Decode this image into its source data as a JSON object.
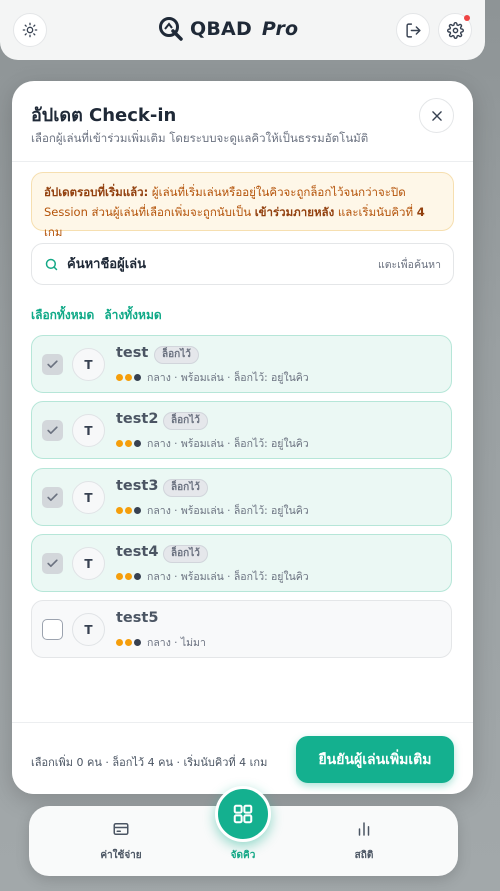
{
  "app": {
    "name": "QBAD",
    "edition": "Pro"
  },
  "modal": {
    "title": "อัปเดต Check-in",
    "subtitle": "เลือกผู้เล่นที่เข้าร่วมเพิ่มเติม โดยระบบจะดูแลคิวให้เป็นธรรมอัตโนมัติ",
    "alert": {
      "lead": "อัปเดตรอบที่เริ่มแล้ว:",
      "text1": " ผู้เล่นที่เริ่มเล่นหรืออยู่ในคิวจะถูกล็อกไว้จนกว่าจะปิด Session ส่วนผู้เล่นที่เลือกเพิ่มจะถูกนับเป็น ",
      "emph": "เข้าร่วมภายหลัง",
      "text2": " และเริ่มนับคิวที่ ",
      "num": "4",
      "text3": " เกม"
    },
    "search": {
      "placeholder": "ค้นหาชื่อผู้เล่น",
      "hint": "แตะเพื่อค้นหา"
    },
    "select_all": "เลือกทั้งหมด",
    "clear_all": "ล้างทั้งหมด",
    "players": [
      {
        "initial": "T",
        "name": "test",
        "badge": "ล็อกไว้",
        "meta": "กลาง · พร้อมเล่น · ล็อกไว้: อยู่ในคิว",
        "checked": true
      },
      {
        "initial": "T",
        "name": "test2",
        "badge": "ล็อกไว้",
        "meta": "กลาง · พร้อมเล่น · ล็อกไว้: อยู่ในคิว",
        "checked": true
      },
      {
        "initial": "T",
        "name": "test3",
        "badge": "ล็อกไว้",
        "meta": "กลาง · พร้อมเล่น · ล็อกไว้: อยู่ในคิว",
        "checked": true
      },
      {
        "initial": "T",
        "name": "test4",
        "badge": "ล็อกไว้",
        "meta": "กลาง · พร้อมเล่น · ล็อกไว้: อยู่ในคิว",
        "checked": true
      },
      {
        "initial": "T",
        "name": "test5",
        "badge": "",
        "meta": "กลาง · ไม่มา",
        "checked": false
      }
    ],
    "footer_info": "เลือกเพิ่ม 0 คน · ล็อกไว้ 4 คน · เริ่มนับคิวที่ 4 เกม",
    "confirm_label": "ยืนยันผู้เล่นเพิ่มเติม"
  },
  "nav": {
    "expenses": "ค่าใช้จ่าย",
    "queue": "จัดคิว",
    "stats": "สถิติ"
  },
  "colors": {
    "accent": "#14b08f",
    "alert_bg": "#fef7e8",
    "checked_row": "#ebf8f4"
  }
}
